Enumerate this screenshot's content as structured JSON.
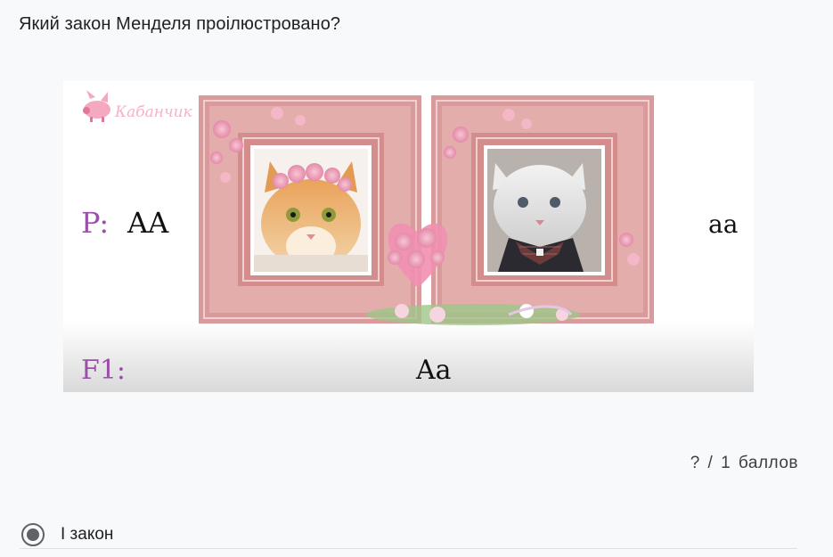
{
  "question": {
    "title": "Який закон Менделя проілюстровано?"
  },
  "illustration": {
    "watermark": "Кабанчик",
    "parent_label": "P:",
    "parent_left": "AA",
    "parent_right": "aa",
    "offspring_label": "F1:",
    "offspring": "Aa"
  },
  "score": {
    "text": "? / 1 баллов"
  },
  "options": [
    {
      "label": "І закон",
      "selected": true
    }
  ],
  "colors": {
    "frame_pink": "#d99a9b",
    "frame_inner": "#e8b8b6",
    "label_purple": "#9b4fa8",
    "radio_grey": "#5f6368"
  }
}
